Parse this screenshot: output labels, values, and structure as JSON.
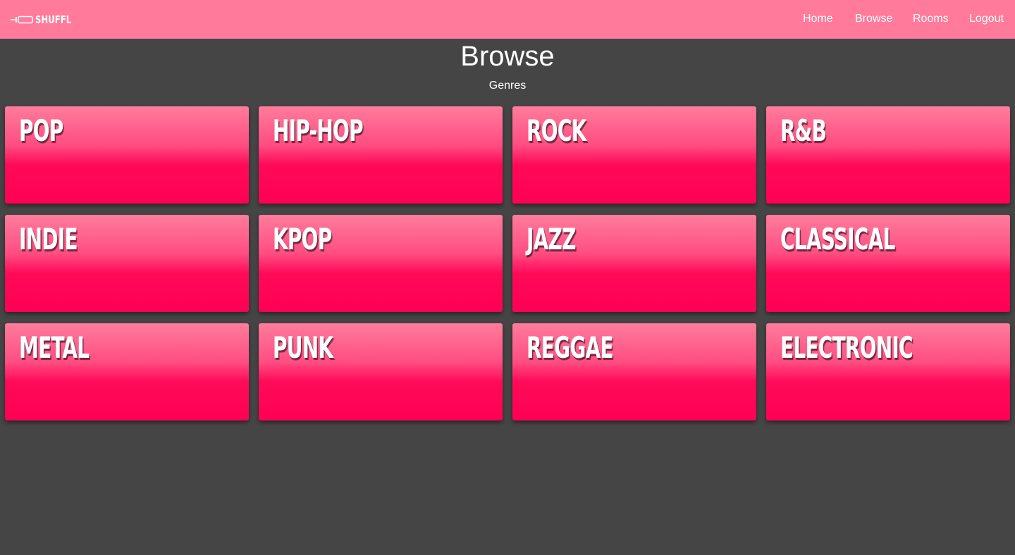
{
  "navbar": {
    "logo_text": "SHUFFL",
    "links": [
      "Home",
      "Browse",
      "Rooms",
      "Logout"
    ],
    "background": "#ff7a9b"
  },
  "page": {
    "title": "Browse",
    "section_label": "Genres",
    "background": "#454545"
  },
  "genres": [
    "POP",
    "HIP-HOP",
    "ROCK",
    "R&B",
    "INDIE",
    "KPOP",
    "JAZZ",
    "CLASSICAL",
    "METAL",
    "PUNK",
    "REGGAE",
    "ELECTRONIC"
  ],
  "colors": {
    "card_top": "#ff7c9c",
    "card_bottom": "#ff0055",
    "text": "#ffffff"
  }
}
